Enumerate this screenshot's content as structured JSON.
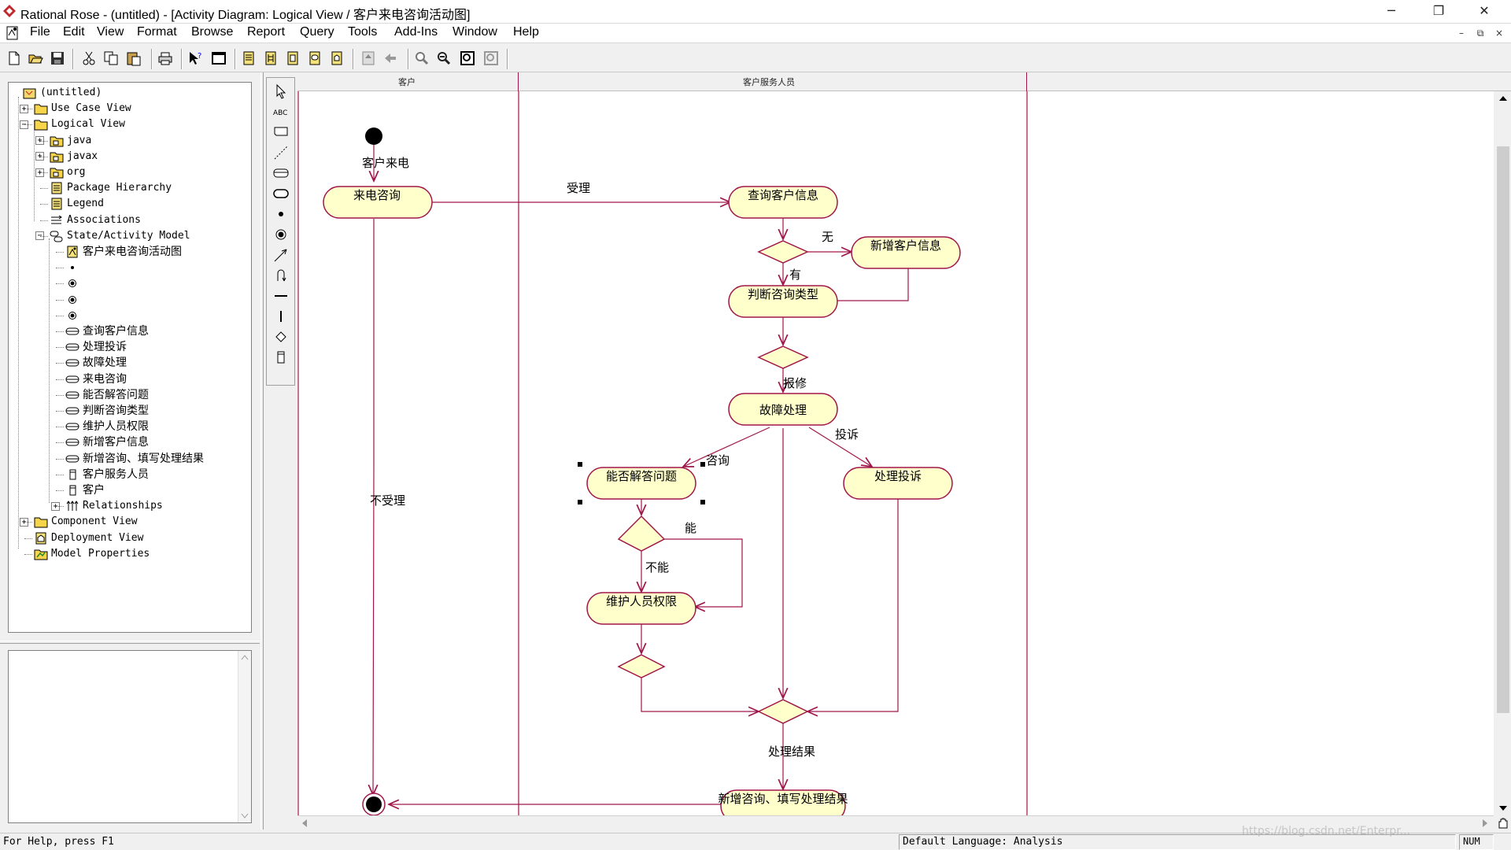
{
  "window": {
    "title": "Rational Rose - (untitled) - [Activity Diagram: Logical View / 客户来电咨询活动图]",
    "minimize": "─",
    "restore": "❐",
    "close": "✕"
  },
  "menu": {
    "items": [
      "File",
      "Edit",
      "View",
      "Format",
      "Browse",
      "Report",
      "Query",
      "Tools",
      "Add-Ins",
      "Window",
      "Help"
    ],
    "mdi_min": "–",
    "mdi_restore": "⧉",
    "mdi_close": "×"
  },
  "toolbar": {
    "buttons": [
      "new",
      "open",
      "save",
      "cut",
      "copy",
      "paste",
      "print",
      "context-help",
      "view-doc",
      "browse-class",
      "browse-interaction",
      "browse-component",
      "browse-deployment",
      "browse-previous",
      "browse-parent",
      "previous-diagram",
      "zoom-in",
      "zoom-out",
      "fit-in-window",
      "undo-fit"
    ]
  },
  "browser": {
    "tree": [
      {
        "label": "(untitled)",
        "icon": "model-icon",
        "level": 0,
        "expander": null
      },
      {
        "label": "Use Case View",
        "icon": "folder-icon",
        "level": 1,
        "expander": "+"
      },
      {
        "label": "Logical View",
        "icon": "folder-icon",
        "level": 1,
        "expander": "-"
      },
      {
        "label": "java",
        "icon": "package-icon",
        "level": 2,
        "expander": "+"
      },
      {
        "label": "javax",
        "icon": "package-icon",
        "level": 2,
        "expander": "+"
      },
      {
        "label": "org",
        "icon": "package-icon",
        "level": 2,
        "expander": "+"
      },
      {
        "label": "Package Hierarchy",
        "icon": "class-diagram-icon",
        "level": 2,
        "expander": null
      },
      {
        "label": "Legend",
        "icon": "class-diagram-icon",
        "level": 2,
        "expander": null
      },
      {
        "label": "Associations",
        "icon": "associations-icon",
        "level": 2,
        "expander": null
      },
      {
        "label": "State/Activity Model",
        "icon": "state-model-icon",
        "level": 2,
        "expander": "-"
      },
      {
        "label": "客户来电咨询活动图",
        "icon": "activity-diagram-icon",
        "level": 3,
        "expander": null
      },
      {
        "label": "",
        "icon": "start-state-icon",
        "level": 3,
        "expander": null
      },
      {
        "label": "",
        "icon": "end-state-icon",
        "level": 3,
        "expander": null
      },
      {
        "label": "",
        "icon": "end-state-icon",
        "level": 3,
        "expander": null
      },
      {
        "label": "",
        "icon": "end-state-icon",
        "level": 3,
        "expander": null
      },
      {
        "label": "查询客户信息",
        "icon": "activity-icon",
        "level": 3,
        "expander": null
      },
      {
        "label": "处理投诉",
        "icon": "activity-icon",
        "level": 3,
        "expander": null
      },
      {
        "label": "故障处理",
        "icon": "activity-icon",
        "level": 3,
        "expander": null
      },
      {
        "label": "来电咨询",
        "icon": "activity-icon",
        "level": 3,
        "expander": null
      },
      {
        "label": "能否解答问题",
        "icon": "activity-icon",
        "level": 3,
        "expander": null
      },
      {
        "label": "判断咨询类型",
        "icon": "activity-icon",
        "level": 3,
        "expander": null
      },
      {
        "label": "维护人员权限",
        "icon": "activity-icon",
        "level": 3,
        "expander": null
      },
      {
        "label": "新增客户信息",
        "icon": "activity-icon",
        "level": 3,
        "expander": null
      },
      {
        "label": "新增咨询、填写处理结果",
        "icon": "activity-icon",
        "level": 3,
        "expander": null
      },
      {
        "label": "客户服务人员",
        "icon": "swimlane-icon",
        "level": 3,
        "expander": null
      },
      {
        "label": "客户",
        "icon": "swimlane-icon",
        "level": 3,
        "expander": null
      },
      {
        "label": "Relationships",
        "icon": "relationships-icon",
        "level": 3,
        "expander": "+"
      },
      {
        "label": "Component View",
        "icon": "folder-icon",
        "level": 1,
        "expander": "+"
      },
      {
        "label": "Deployment View",
        "icon": "deployment-icon",
        "level": 1,
        "expander": null
      },
      {
        "label": "Model Properties",
        "icon": "properties-icon",
        "level": 1,
        "expander": null
      }
    ]
  },
  "palette": {
    "tools": [
      "selection-tool",
      "text-box-tool",
      "note-tool",
      "anchor-note-tool",
      "state-tool",
      "activity-tool",
      "start-state-tool",
      "end-state-tool",
      "transition-tool",
      "self-transition-tool",
      "horizontal-sync-tool",
      "vertical-sync-tool",
      "decision-tool",
      "swimlane-tool"
    ],
    "text_box_label": "ABC"
  },
  "diagram": {
    "swimlanes": [
      "客户",
      "客户服务人员"
    ],
    "activities": [
      "来电咨询",
      "查询客户信息",
      "新增客户信息",
      "判断咨询类型",
      "故障处理",
      "能否解答问题",
      "处理投诉",
      "维护人员权限",
      "新增咨询、填写处理结果"
    ],
    "transitions": [
      "客户来电",
      "受理",
      "无",
      "有",
      "报修",
      "咨询",
      "投诉",
      "能",
      "不能",
      "处理结果",
      "不受理"
    ],
    "colors": {
      "line": "#a0164a",
      "activity_fill": "#ffffcc",
      "activity_border": "#a0164a",
      "canvas": "#ffffff",
      "start": "#000000"
    }
  },
  "status": {
    "help": "For Help, press F1",
    "language": "Default Language: Analysis",
    "num": "NUM"
  },
  "watermark": "https://blog.csdn.net/Enterpr..."
}
